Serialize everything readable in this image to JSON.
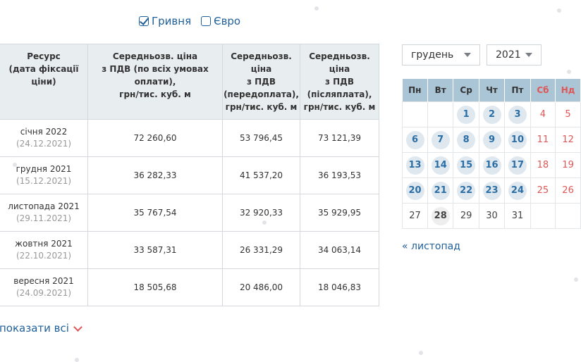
{
  "currency": {
    "options": [
      {
        "label": "Гривня",
        "checked": true
      },
      {
        "label": "Євро",
        "checked": false
      }
    ]
  },
  "table": {
    "headers": [
      "Ресурс\n(дата фіксації\nціни)",
      "Середньозв. ціна\nз ПДВ (по всіх умовах\nоплати),\nгрн/тис. куб. м",
      "Середньозв.\nціна\nз ПДВ\n(передоплата),\nгрн/тис. куб. м",
      "Середньозв. ціна\nз ПДВ\n(післяплата),\nгрн/тис. куб. м"
    ],
    "rows": [
      {
        "resource": "січня 2022",
        "date": "(24.12.2021)",
        "p1": "72 260,60",
        "p2": "53 796,45",
        "p3": "73 121,39"
      },
      {
        "resource": "грудня 2021",
        "date": "(15.12.2021)",
        "p1": "36 282,33",
        "p2": "41 537,20",
        "p3": "36 193,53"
      },
      {
        "resource": "листопада 2021",
        "date": "(29.11.2021)",
        "p1": "35 767,54",
        "p2": "32 920,33",
        "p3": "35 929,95"
      },
      {
        "resource": "жовтня 2021",
        "date": "(22.10.2021)",
        "p1": "33 587,31",
        "p2": "26 331,29",
        "p3": "34 063,14"
      },
      {
        "resource": "вересня 2021",
        "date": "(24.09.2021)",
        "p1": "18 505,68",
        "p2": "20 486,00",
        "p3": "18 046,83"
      }
    ]
  },
  "show_all_label": "показати всі",
  "selects": {
    "month": "грудень",
    "year": "2021"
  },
  "calendar": {
    "weekdays": [
      "Пн",
      "Вт",
      "Ср",
      "Чт",
      "Пт",
      "Сб",
      "Нд"
    ],
    "weeks": [
      [
        null,
        null,
        "1",
        "2",
        "3",
        "4",
        "5"
      ],
      [
        "6",
        "7",
        "8",
        "9",
        "10",
        "11",
        "12"
      ],
      [
        "13",
        "14",
        "15",
        "16",
        "17",
        "18",
        "19"
      ],
      [
        "20",
        "21",
        "22",
        "23",
        "24",
        "25",
        "26"
      ],
      [
        "27",
        "28",
        "29",
        "30",
        "31",
        null,
        null
      ]
    ],
    "linked_days": [
      "1",
      "2",
      "3",
      "6",
      "7",
      "8",
      "9",
      "10",
      "13",
      "14",
      "15",
      "16",
      "17",
      "20",
      "21",
      "22",
      "23",
      "24"
    ],
    "today": "28",
    "prev_month_link": "« листопад"
  }
}
